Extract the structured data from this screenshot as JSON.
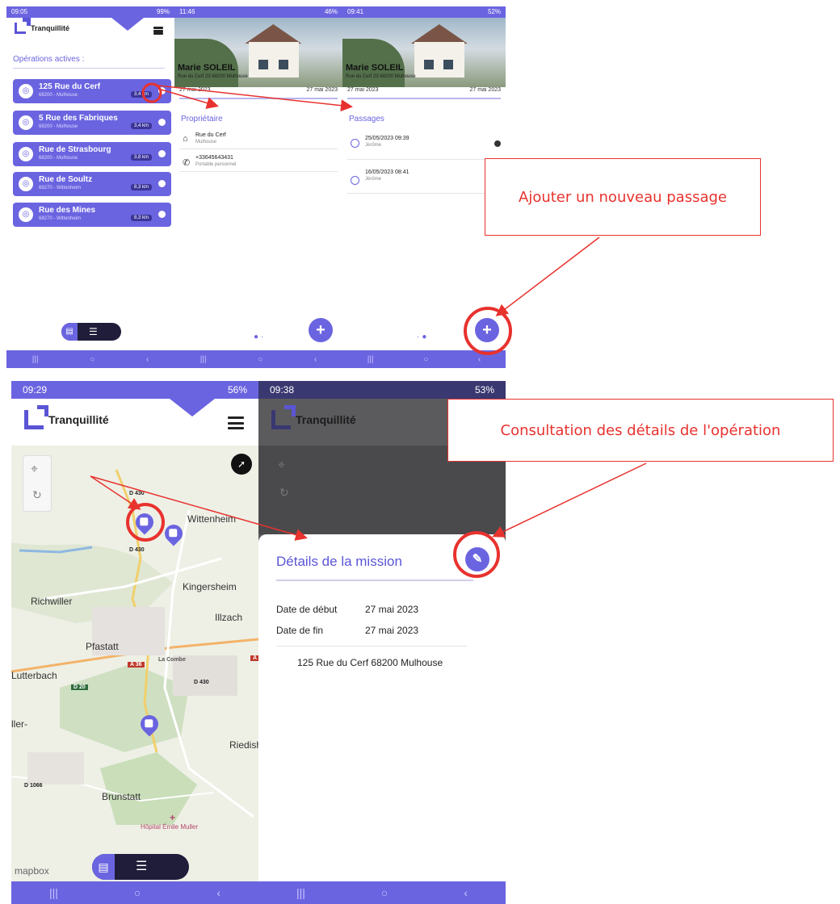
{
  "colors": {
    "brand": "#6b64e0",
    "annotation": "#e8322e",
    "dark": "#1f1d3a"
  },
  "app": {
    "name": "Tranquillité"
  },
  "phone1": {
    "status_time": "09:05",
    "status_right": "99%",
    "section_title": "Opérations actives :",
    "operations": [
      {
        "street": "125 Rue du Cerf",
        "city": "68200 - Mulhouse",
        "distance": "3,4 km"
      },
      {
        "street": "5 Rue des Fabriques",
        "city": "68200 - Mulhouse",
        "distance": "3,4 km"
      },
      {
        "street": "Rue de Strasbourg",
        "city": "68200 - Mulhouse",
        "distance": "3,8 km"
      },
      {
        "street": "Rue de Soultz",
        "city": "68270 - Wittenheim",
        "distance": "8,3 km"
      },
      {
        "street": "Rue des Mines",
        "city": "68270 - Wittenheim",
        "distance": "8,3 km"
      }
    ],
    "toggle_icons": [
      "list-icon",
      "filter-icon"
    ]
  },
  "phone2": {
    "status_time": "11:46",
    "status_right": "46%",
    "owner_name": "Marie SOLEIL",
    "owner_address": "Rue du Cerf 23 68200 Mulhouse",
    "date_start": "27 mai 2023",
    "date_end": "27 mai 2023",
    "section_title": "Propriétaire",
    "address_line1": "Rue du Cerf",
    "address_line2": "Mulhouse",
    "phone_number": "+33645643431",
    "phone_type": "Portable personnel",
    "fab_symbol": "+"
  },
  "phone3": {
    "status_time": "09:41",
    "status_right": "52%",
    "owner_name": "Marie SOLEIL",
    "owner_address": "Rue du Cerf 23 68200 Mulhouse",
    "date_start": "27 mai 2023",
    "date_end": "27 mai 2023",
    "section_title": "Passages",
    "passages": [
      {
        "datetime": "25/05/2023 09:39",
        "agent": "Jérôme"
      },
      {
        "datetime": "16/05/2023 08:41",
        "agent": "Jérôme"
      }
    ],
    "fab_symbol": "+"
  },
  "phone4": {
    "status_time": "09:29",
    "status_right": "56%",
    "places": [
      "Wittenheim",
      "Kingersheim",
      "Richwiller",
      "Illzach",
      "Pfastatt",
      "Lutterbach",
      "Riedishe",
      "Brunstatt",
      "ller-",
      "Hôpital Émile Muller"
    ],
    "road_labels": [
      "D 430",
      "D 430",
      "La Combe",
      "D 430",
      "D 1066"
    ],
    "shields": [
      "D 20",
      "A 36",
      "A"
    ],
    "attribution": "mapbox"
  },
  "phone5": {
    "status_time": "09:38",
    "status_right": "53%",
    "sheet_title": "Détails de la mission",
    "start_label": "Date de début",
    "start_value": "27 mai 2023",
    "end_label": "Date de fin",
    "end_value": "27 mai 2023",
    "address": "125 Rue du Cerf 68200 Mulhouse"
  },
  "annotations": {
    "add_passage": "Ajouter un nouveau passage",
    "consult_details": "Consultation des détails de l'opération"
  },
  "nav_icons": [
    "recent-apps-icon",
    "home-icon",
    "back-icon"
  ]
}
